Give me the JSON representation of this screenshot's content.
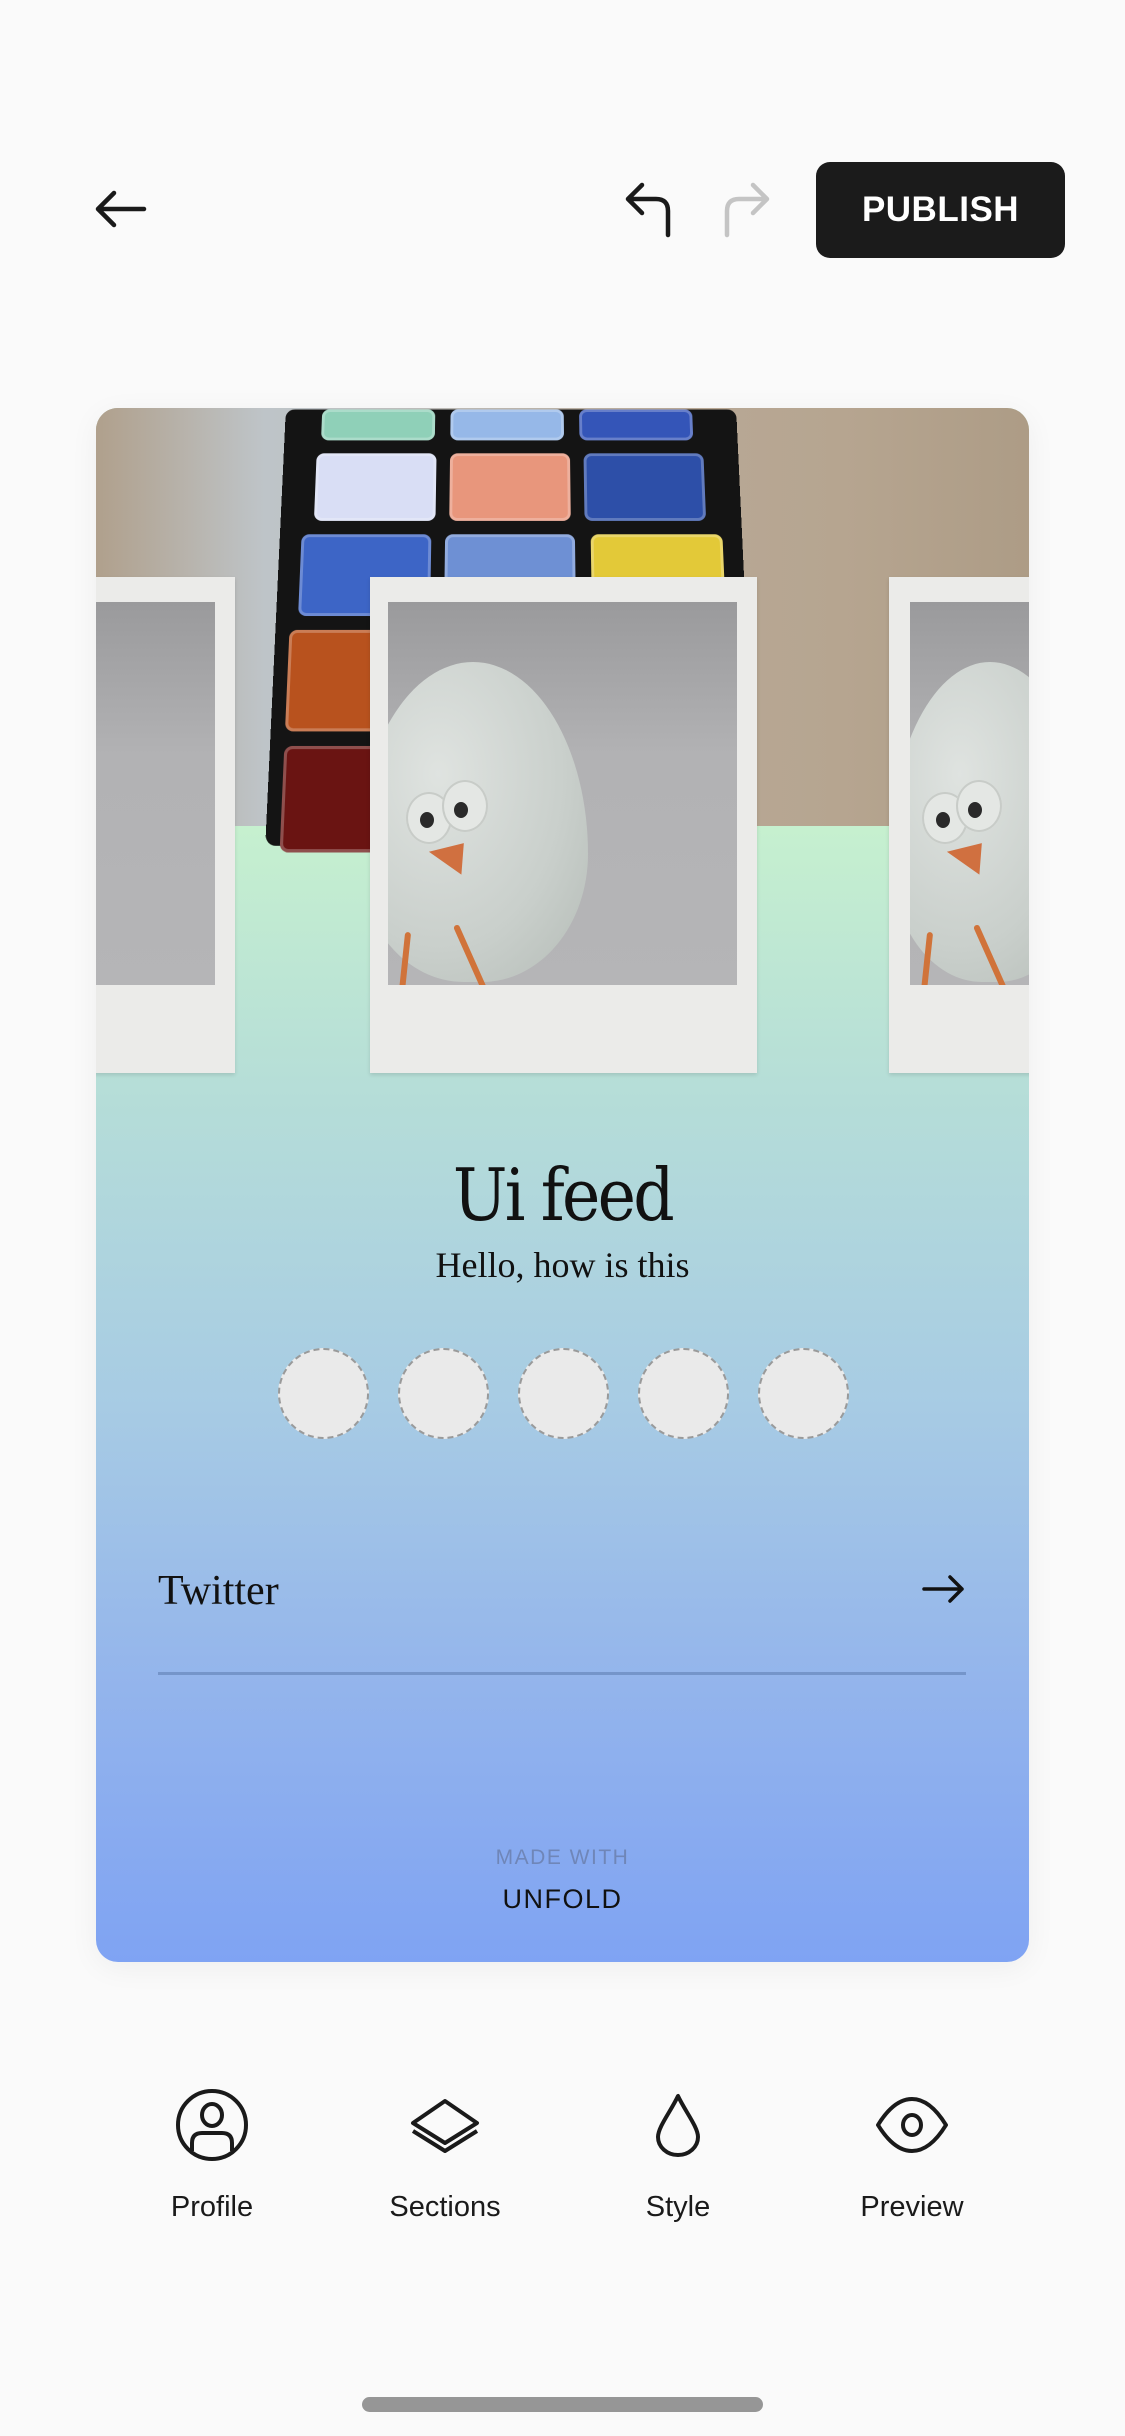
{
  "topbar": {
    "back_icon": "arrow-left-icon",
    "undo_icon": "undo-arrow-icon",
    "redo_icon": "redo-arrow-icon",
    "redo_enabled": false,
    "publish_label": "PUBLISH"
  },
  "card": {
    "cover_image": "rubiks-cube-photo",
    "gallery": [
      {
        "image": "gray-photo"
      },
      {
        "image": "egg-chick-photo"
      },
      {
        "image": "egg-chick-photo"
      }
    ],
    "title": "Ui feed",
    "subtitle": "Hello, how is this",
    "social_slots": 5,
    "links": [
      {
        "label": "Twitter",
        "icon": "arrow-right-icon"
      }
    ],
    "footer": {
      "made_with": "MADE WITH",
      "brand": "UNFOLD"
    },
    "colors": {
      "gradient_top": "#c6f0cf",
      "gradient_mid": "#a7cbe4",
      "gradient_bottom": "#7fa3f3"
    }
  },
  "bottom_nav": {
    "items": [
      {
        "label": "Profile",
        "icon": "profile-icon"
      },
      {
        "label": "Sections",
        "icon": "layers-icon"
      },
      {
        "label": "Style",
        "icon": "drop-icon"
      },
      {
        "label": "Preview",
        "icon": "eye-icon"
      }
    ]
  },
  "colors": {
    "background": "#fafafa",
    "publish_bg": "#1b1b1b",
    "disabled_icon": "#c4c4c4"
  }
}
